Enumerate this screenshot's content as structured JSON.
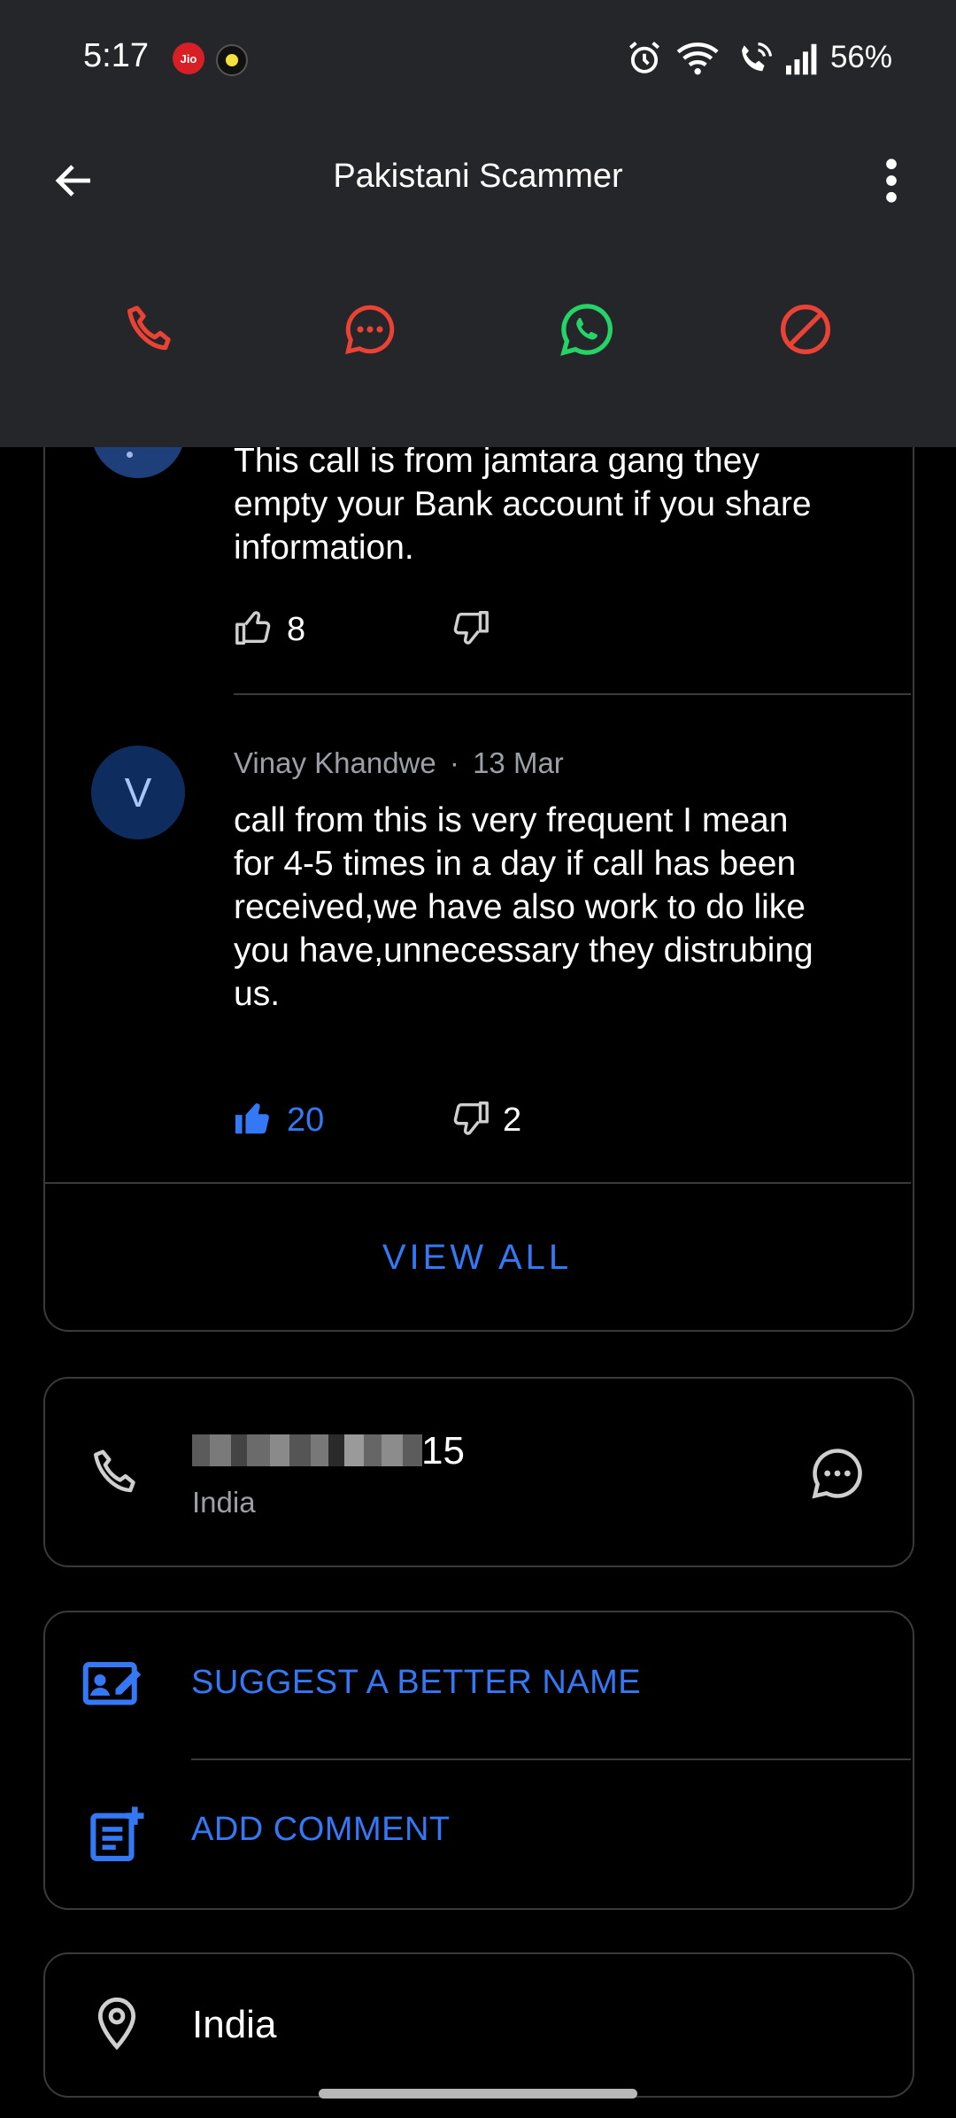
{
  "status_bar": {
    "time": "5:17",
    "battery": "56%",
    "carrier_badge": "Jio"
  },
  "header": {
    "title": "Pakistani Scammer"
  },
  "colors": {
    "action_red": "#ea4335",
    "whatsapp_green": "#25d366",
    "link_blue": "#3478f6",
    "header_bg": "#25262a"
  },
  "comments": [
    {
      "text": "This call is from jamtara gang they empty your Bank account if you share information.",
      "likes": "8",
      "dislikes": ""
    },
    {
      "author_initial": "V",
      "author": "Vinay Khandwe",
      "separator": "·",
      "date": "13 Mar",
      "text": "call from this is very frequent I mean for 4-5 times in a day if call has been received,we have also work to do like you have,unnecessary they distrubing us.",
      "likes": "20",
      "dislikes": "2"
    }
  ],
  "view_all_label": "VIEW ALL",
  "number_card": {
    "number_suffix": "15",
    "country": "India"
  },
  "actions": {
    "suggest_label": "SUGGEST A BETTER NAME",
    "add_comment_label": "ADD COMMENT"
  },
  "location": {
    "label": "India"
  }
}
